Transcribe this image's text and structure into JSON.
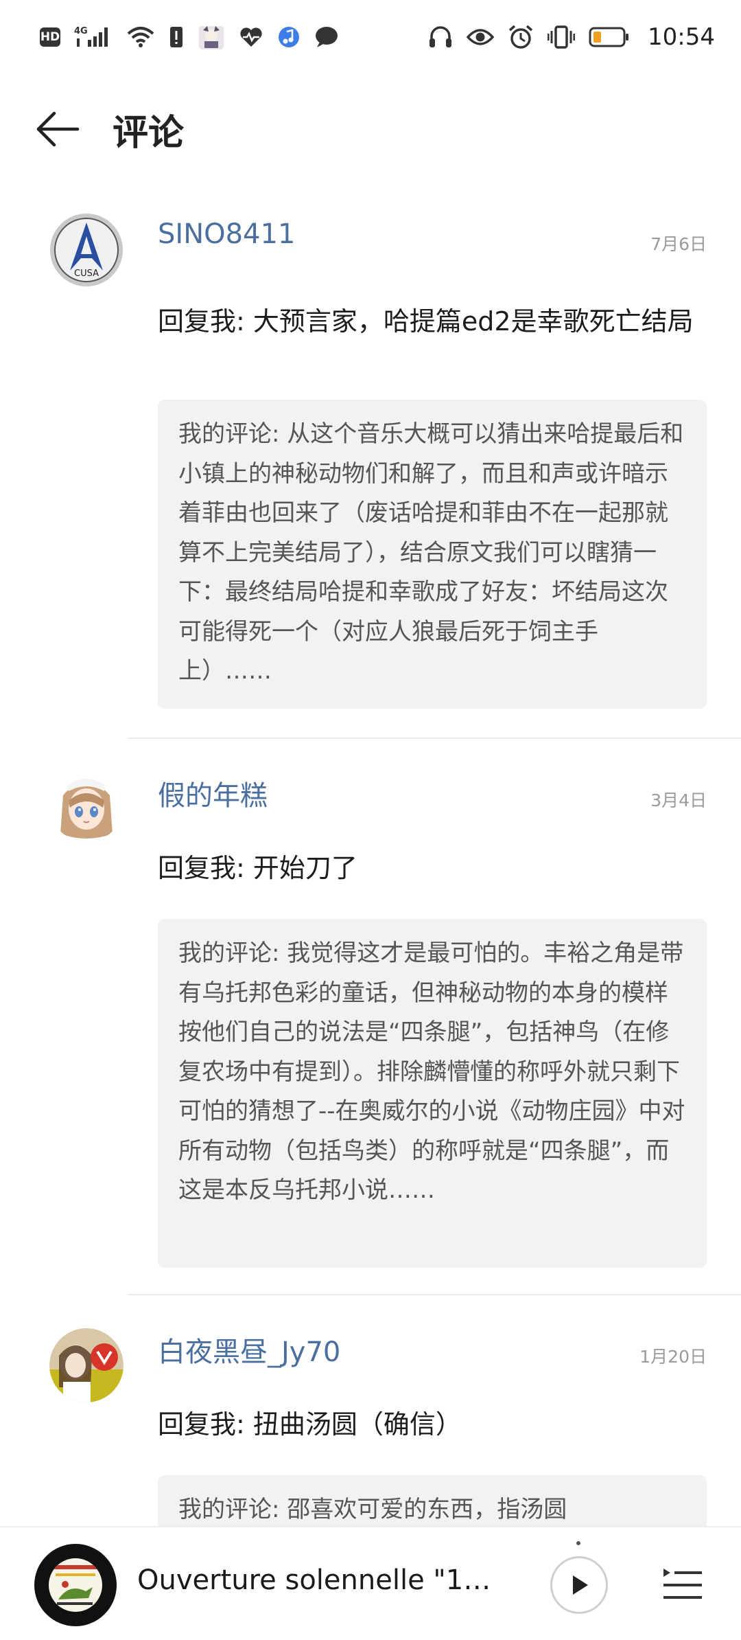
{
  "status_bar": {
    "hd": "HD",
    "network": "4G",
    "time": "10:54"
  },
  "header": {
    "title": "评论"
  },
  "comments": [
    {
      "user": "SINO8411",
      "date": "7月6日",
      "avatar_text": "CUSA",
      "reply_prefix": "回复我:",
      "reply_text": "大预言家，哈提篇ed2是幸歌死亡结局",
      "quote_prefix": "我的评论:",
      "quote_text": "从这个音乐大概可以猜出来哈提最后和小镇上的神秘动物们和解了，而且和声或许暗示着菲由也回来了（废话哈提和菲由不在一起那就算不上完美结局了），结合原文我们可以瞎猜一下：最终结局哈提和幸歌成了好友：坏结局这次可能得死一个（对应人狼最后死于饲主手上）……"
    },
    {
      "user": "假的年糕",
      "date": "3月4日",
      "reply_prefix": "回复我:",
      "reply_text": "开始刀了",
      "quote_prefix": "我的评论:",
      "quote_text": "我觉得这才是最可怕的。丰裕之角是带有乌托邦色彩的童话，但神秘动物的本身的模样按他们自己的说法是“四条腿”，包括神鸟（在修复农场中有提到）。排除麟懵懂的称呼外就只剩下可怕的猜想了--在奥威尔的小说《动物庄园》中对所有动物（包括鸟类）的称呼就是“四条腿”，而这是本反乌托邦小说……"
    },
    {
      "user": "白夜黑昼_Jy70",
      "date": "1月20日",
      "reply_prefix": "回复我:",
      "reply_text": "扭曲汤圆（确信）",
      "quote_prefix": "我的评论:",
      "quote_text": "邵喜欢可爱的东西，指汤圆"
    }
  ],
  "player": {
    "now_playing": "Ouverture solennelle \"1…"
  },
  "colors": {
    "username": "#4a6f9e",
    "quote_bg": "#f2f2f2",
    "battery_low": "#f0a020"
  }
}
